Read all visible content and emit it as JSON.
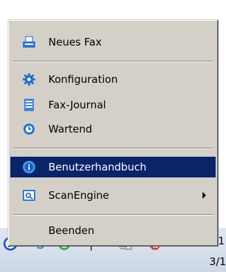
{
  "menu": {
    "items": [
      {
        "label": "Neues Fax",
        "icon": "fax-printer-icon"
      },
      {
        "label": "Konfiguration",
        "icon": "gear-icon"
      },
      {
        "label": "Fax-Journal",
        "icon": "journal-icon"
      },
      {
        "label": "Wartend",
        "icon": "clock-icon"
      },
      {
        "label": "Benutzerhandbuch",
        "icon": "info-icon"
      },
      {
        "label": "ScanEngine",
        "icon": "scan-icon"
      },
      {
        "label": "Beenden"
      }
    ]
  },
  "taskbar": {
    "clock_line1": "1",
    "clock_line2": "3/1",
    "icons": [
      "fax-tray-icon",
      "network-icon",
      "messenger-icon",
      "flag-icon",
      "computer-icon",
      "volume-muted-icon"
    ]
  },
  "colors": {
    "menu_bg": "#d4d0c8",
    "highlight": "#0a246a",
    "highlight_text": "#ffffff"
  }
}
